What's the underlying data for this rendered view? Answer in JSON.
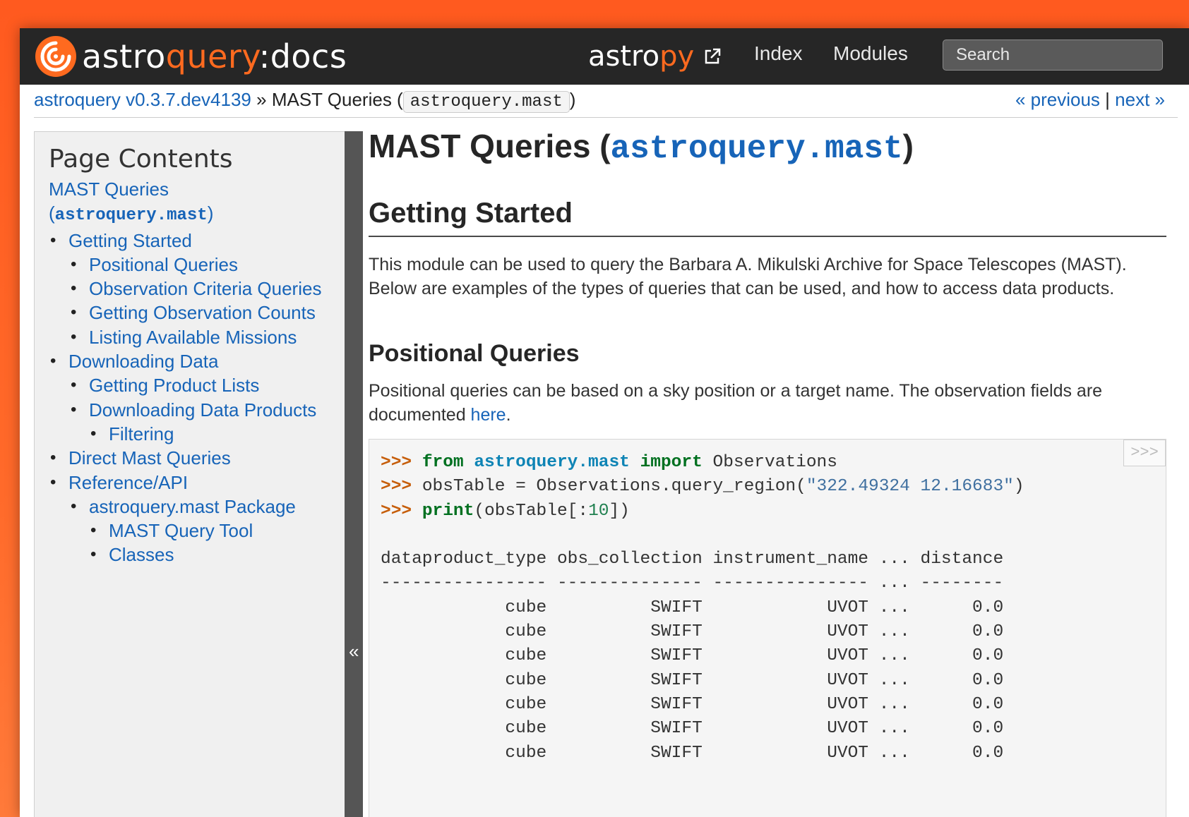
{
  "header": {
    "logo_main": "astro",
    "logo_accent": "query",
    "logo_suffix": ":docs",
    "astropy_main": "astro",
    "astropy_accent": "py",
    "nav_index": "Index",
    "nav_modules": "Modules",
    "search_placeholder": "Search",
    "accent_color": "#ff6a1f"
  },
  "breadcrumb": {
    "version_link": "astroquery v0.3.7.dev4139",
    "separator": "»",
    "current_prefix": "MAST Queries (",
    "current_code": "astroquery.mast",
    "current_suffix": ")",
    "previous": "« previous",
    "divider": "|",
    "next": "next »"
  },
  "sidebar": {
    "title": "Page Contents",
    "top_link": "MAST Queries",
    "top_link_code_open": "(",
    "top_link_code": "astroquery.mast",
    "top_link_code_close": ")",
    "items": [
      {
        "label": "Getting Started",
        "level": 1
      },
      {
        "label": "Positional Queries",
        "level": 2
      },
      {
        "label": "Observation Criteria Queries",
        "level": 2
      },
      {
        "label": "Getting Observation Counts",
        "level": 2
      },
      {
        "label": "Listing Available Missions",
        "level": 2
      },
      {
        "label": "Downloading Data",
        "level": 1
      },
      {
        "label": "Getting Product Lists",
        "level": 2
      },
      {
        "label": "Downloading Data Products",
        "level": 2
      },
      {
        "label": "Filtering",
        "level": 3
      },
      {
        "label": "Direct Mast Queries",
        "level": 1
      },
      {
        "label": "Reference/API",
        "level": 1
      },
      {
        "label": "astroquery.mast Package",
        "level": 2
      },
      {
        "label": "MAST Query Tool",
        "level": 3
      },
      {
        "label": "Classes",
        "level": 3
      }
    ],
    "collapse_glyph": "«"
  },
  "main": {
    "title_text": "MAST Queries (",
    "title_code": "astroquery.mast",
    "title_close": ")",
    "section_title": "Getting Started",
    "intro": "This module can be used to query the Barbara A. Mikulski Archive for Space Telescopes (MAST). Below are examples of the types of queries that can be used, and how to access data products.",
    "subsection_title": "Positional Queries",
    "positional_text": "Positional queries can be based on a sky position or a target name. The observation fields are documented ",
    "positional_link": "here",
    "positional_end": ".",
    "code": {
      "copy_label": ">>>",
      "prompt": ">>>",
      "line1_from": "from",
      "line1_module": "astroquery.mast",
      "line1_import": "import",
      "line1_name": "Observations",
      "line2_pre": "obsTable = Observations.query_region(",
      "line2_string": "\"322.49324 12.16683\"",
      "line2_post": ")",
      "line3_print": "print",
      "line3_pre": "(obsTable[:",
      "line3_num": "10",
      "line3_post": "])",
      "table_header": "dataproduct_type obs_collection instrument_name ... distance",
      "table_rule": "---------------- -------------- --------------- ... --------",
      "table_rows": [
        "            cube          SWIFT            UVOT ...      0.0",
        "            cube          SWIFT            UVOT ...      0.0",
        "            cube          SWIFT            UVOT ...      0.0",
        "            cube          SWIFT            UVOT ...      0.0",
        "            cube          SWIFT            UVOT ...      0.0",
        "            cube          SWIFT            UVOT ...      0.0",
        "            cube          SWIFT            UVOT ...      0.0"
      ]
    }
  }
}
